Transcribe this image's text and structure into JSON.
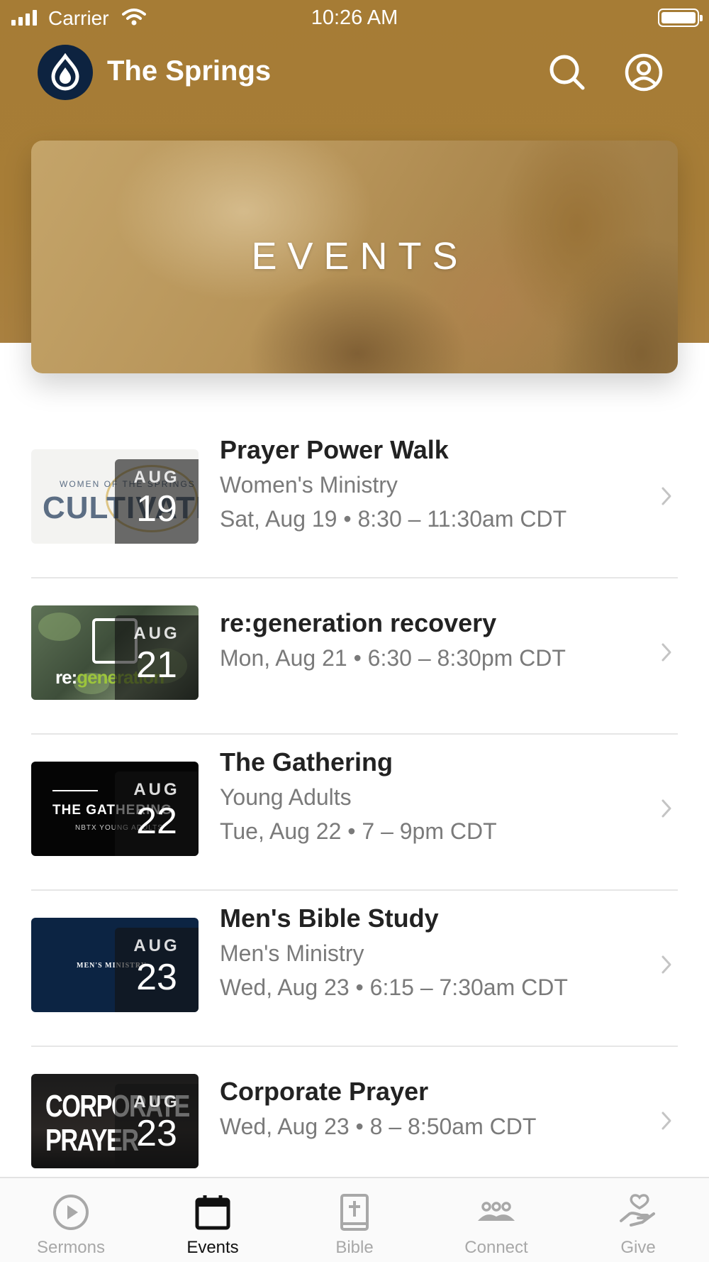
{
  "status_bar": {
    "carrier": "Carrier",
    "time": "10:26 AM"
  },
  "header": {
    "app_title": "The Springs",
    "logo_icon": "springs-drop-logo",
    "search_icon": "search-icon",
    "profile_icon": "user-circle-icon"
  },
  "hero": {
    "title": "EVENTS"
  },
  "events": [
    {
      "title": "Prayer Power Walk",
      "ministry": "Women's Ministry",
      "when": "Sat, Aug 19 • 8:30 – 11:30am CDT",
      "month": "AUG",
      "day": "19",
      "thumb_text": "CULTIVATE",
      "thumb_small": "WOMEN OF THE SPRINGS"
    },
    {
      "title": "re:generation recovery",
      "ministry": "",
      "when": "Mon, Aug 21 • 6:30 – 8:30pm CDT",
      "month": "AUG",
      "day": "21",
      "thumb_text": "re:generation"
    },
    {
      "title": "The Gathering",
      "ministry": "Young Adults",
      "when": "Tue, Aug 22 • 7 – 9pm CDT",
      "month": "AUG",
      "day": "22",
      "thumb_text": "THE GATHERING",
      "thumb_small": "NBTX YOUNG ADULTS"
    },
    {
      "title": "Men's Bible Study",
      "ministry": "Men's Ministry",
      "when": "Wed, Aug 23 • 6:15 – 7:30am CDT",
      "month": "AUG",
      "day": "23",
      "thumb_text": "MEN'S MINISTRY"
    },
    {
      "title": "Corporate Prayer",
      "ministry": "",
      "when": "Wed, Aug 23 • 8 – 8:50am CDT",
      "month": "AUG",
      "day": "23",
      "thumb_text": "CORPORATE PRAYER"
    }
  ],
  "tabs": [
    {
      "label": "Sermons",
      "icon": "play-circle-icon",
      "active": false
    },
    {
      "label": "Events",
      "icon": "calendar-icon",
      "active": true
    },
    {
      "label": "Bible",
      "icon": "bible-icon",
      "active": false
    },
    {
      "label": "Connect",
      "icon": "people-icon",
      "active": false
    },
    {
      "label": "Give",
      "icon": "heart-hand-icon",
      "active": false
    }
  ],
  "colors": {
    "header_bg": "#a67c35",
    "logo_bg": "#0d2340",
    "tab_active": "#111111",
    "tab_inactive": "#a8a8a8"
  }
}
